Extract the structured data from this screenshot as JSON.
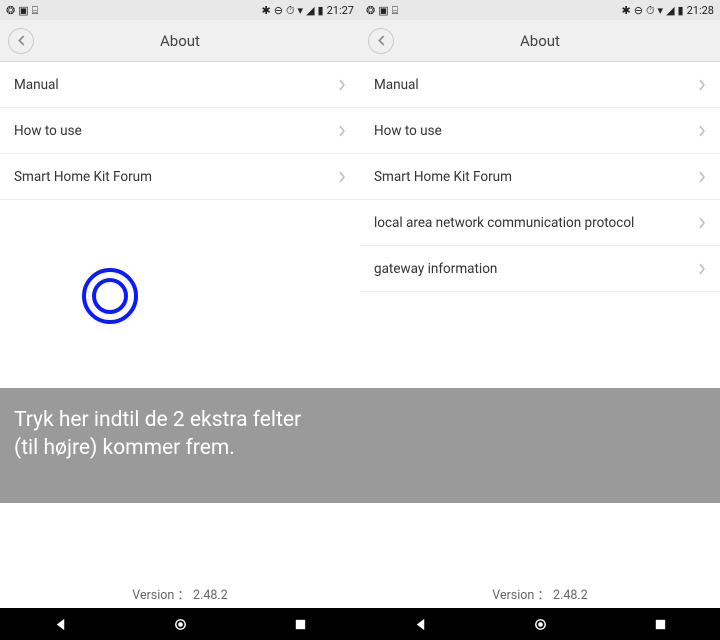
{
  "left": {
    "status_time": "21:27",
    "header_title": "About",
    "rows": [
      {
        "label": "Manual"
      },
      {
        "label": "How to use"
      },
      {
        "label": "Smart Home Kit Forum"
      }
    ],
    "version": "Version ： 2.48.2"
  },
  "right": {
    "status_time": "21:28",
    "header_title": "About",
    "rows": [
      {
        "label": "Manual"
      },
      {
        "label": "How to use"
      },
      {
        "label": "Smart Home Kit Forum"
      },
      {
        "label": "local area network communication protocol"
      },
      {
        "label": "gateway information"
      }
    ],
    "version": "Version ： 2.48.2"
  },
  "caption_line1": "Tryk her indtil de 2 ekstra felter",
  "caption_line2": "(til højre) kommer frem."
}
